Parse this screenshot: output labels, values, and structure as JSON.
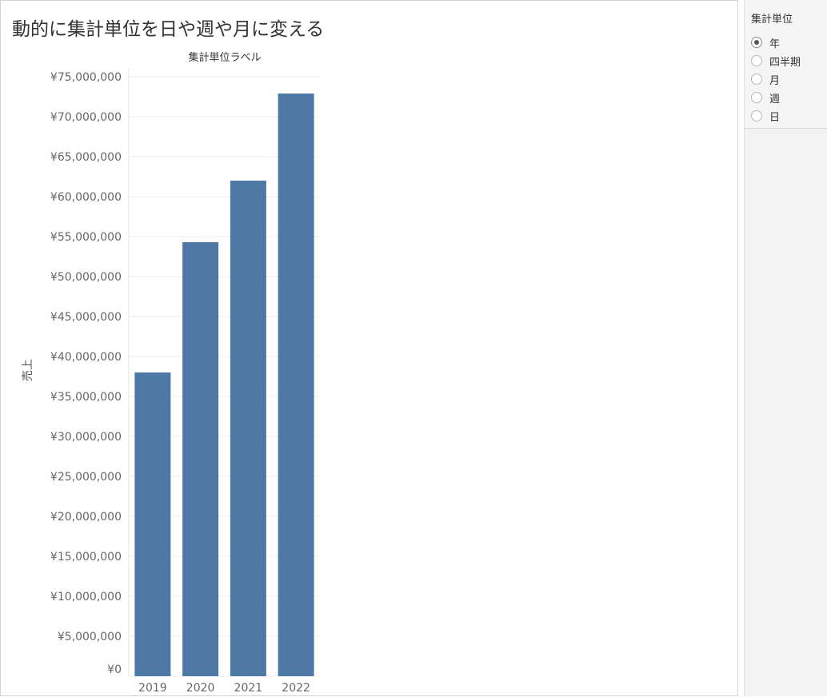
{
  "dashboard": {
    "title": "動的に集計単位を日や週や月に変える"
  },
  "filter": {
    "title": "集計単位",
    "options": [
      {
        "label": "年",
        "selected": true
      },
      {
        "label": "四半期",
        "selected": false
      },
      {
        "label": "月",
        "selected": false
      },
      {
        "label": "週",
        "selected": false
      },
      {
        "label": "日",
        "selected": false
      }
    ]
  },
  "chart_data": {
    "type": "bar",
    "title": "集計単位ラベル",
    "xlabel": "",
    "ylabel": "売上",
    "categories": [
      "2019",
      "2020",
      "2021",
      "2022"
    ],
    "values": [
      38000000,
      54300000,
      62000000,
      72900000
    ],
    "ylim": [
      0,
      75000000
    ],
    "yticks": [
      0,
      5000000,
      10000000,
      15000000,
      20000000,
      25000000,
      30000000,
      35000000,
      40000000,
      45000000,
      50000000,
      55000000,
      60000000,
      65000000,
      70000000,
      75000000
    ],
    "ytick_labels": [
      "¥0",
      "¥5,000,000",
      "¥10,000,000",
      "¥15,000,000",
      "¥20,000,000",
      "¥25,000,000",
      "¥30,000,000",
      "¥35,000,000",
      "¥40,000,000",
      "¥45,000,000",
      "¥50,000,000",
      "¥55,000,000",
      "¥60,000,000",
      "¥65,000,000",
      "¥70,000,000",
      "¥75,000,000"
    ],
    "grid": true,
    "colors": {
      "bar": "#4e79a7",
      "grid": "#ececec",
      "axis_text": "#666666"
    }
  }
}
